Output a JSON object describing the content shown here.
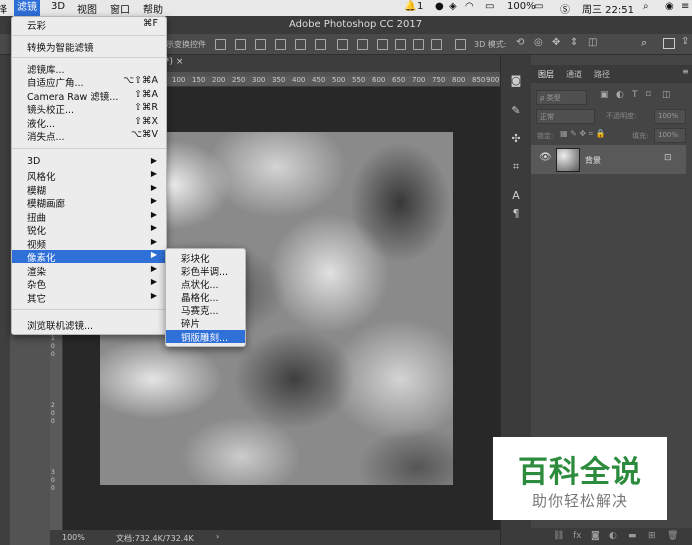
{
  "menubar": {
    "items": [
      "择",
      "滤镜",
      "3D",
      "视图",
      "窗口",
      "帮助"
    ],
    "status": {
      "badge": "1",
      "battery": "100%",
      "clock": "周三 22:51"
    }
  },
  "window": {
    "title": "Adobe Photoshop CC 2017"
  },
  "optbar": {
    "show_transform": "示变换控件",
    "mode_3d": "3D 模式:"
  },
  "doc": {
    "tab_suffix": "*) ×",
    "zoom": "100%",
    "doc_info": "文档:732.4K/732.4K",
    "arrow": "›"
  },
  "ruler": {
    "top": [
      "100",
      "150",
      "200",
      "250",
      "300",
      "350",
      "400",
      "450",
      "500",
      "550",
      "600",
      "650",
      "700",
      "750",
      "800",
      "850",
      "900"
    ],
    "left": [
      "1",
      "0",
      "0",
      "2",
      "0",
      "0",
      "3",
      "0",
      "0"
    ]
  },
  "filter_menu": {
    "items": [
      {
        "label": "云彩",
        "shortcut": "⌘F"
      },
      {
        "label": "转换为智能滤镜",
        "shortcut": ""
      },
      {
        "label": "滤镜库...",
        "shortcut": ""
      },
      {
        "label": "自适应广角...",
        "shortcut": "⌥⇧⌘A"
      },
      {
        "label": "Camera Raw 滤镜...",
        "shortcut": "⇧⌘A"
      },
      {
        "label": "镜头校正...",
        "shortcut": "⇧⌘R"
      },
      {
        "label": "液化...",
        "shortcut": "⇧⌘X"
      },
      {
        "label": "消失点...",
        "shortcut": "⌥⌘V"
      },
      {
        "label": "3D",
        "shortcut": ""
      },
      {
        "label": "风格化",
        "shortcut": ""
      },
      {
        "label": "模糊",
        "shortcut": ""
      },
      {
        "label": "模糊画廊",
        "shortcut": ""
      },
      {
        "label": "扭曲",
        "shortcut": ""
      },
      {
        "label": "锐化",
        "shortcut": ""
      },
      {
        "label": "视频",
        "shortcut": ""
      },
      {
        "label": "像素化",
        "shortcut": ""
      },
      {
        "label": "渲染",
        "shortcut": ""
      },
      {
        "label": "杂色",
        "shortcut": ""
      },
      {
        "label": "其它",
        "shortcut": ""
      },
      {
        "label": "浏览联机滤镜...",
        "shortcut": ""
      }
    ]
  },
  "pixelate_submenu": {
    "items": [
      "彩块化",
      "彩色半调...",
      "点状化...",
      "晶格化...",
      "马赛克...",
      "碎片",
      "铜版雕刻..."
    ],
    "selected": "铜版雕刻..."
  },
  "layers_panel": {
    "tabs": [
      "图层",
      "通道",
      "路径"
    ],
    "filter_kind": "ρ 类型",
    "blend_mode": "正常",
    "opacity_label": "不透明度:",
    "opacity_value": "100%",
    "lock_label": "锁定:",
    "fill_label": "填充:",
    "fill_value": "100%",
    "layer_name": "背景"
  },
  "watermark": {
    "title": "百科全说",
    "subtitle": "助你轻松解决"
  },
  "colors": {
    "highlight": "#2f6fd8",
    "watermark_green": "#2d8b3e"
  }
}
